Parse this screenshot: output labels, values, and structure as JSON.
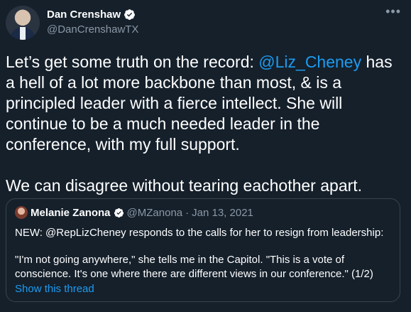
{
  "tweet": {
    "author_name": "Dan Crenshaw",
    "author_handle": "@DanCrenshawTX",
    "more_icon": "•••",
    "text_before_mention": "Let’s get some truth on the record: ",
    "mention": "@Liz_Cheney",
    "text_after_mention": " has a hell of a lot more backbone than most, & is a principled leader with a fierce intellect. She will continue to be a much needed leader in the conference, with my full support.",
    "text_paragraph_2": "We can disagree without tearing eachother apart."
  },
  "quoted_tweet": {
    "author_name": "Melanie Zanona",
    "author_handle": "@MZanona",
    "separator": "·",
    "date": "Jan 13, 2021",
    "text_paragraph_1": "NEW: @RepLizCheney responds to the calls for her to resign from leadership:",
    "text_paragraph_2": "\"I'm not going anywhere,\" she tells me in the Capitol. \"This is a vote of conscience. It's one where there are different views in our conference.\" (1/2)",
    "show_thread_label": "Show this thread"
  },
  "colors": {
    "background": "#15202b",
    "link": "#1d9bf0",
    "secondary_text": "#8b98a5",
    "border": "#38444d"
  }
}
